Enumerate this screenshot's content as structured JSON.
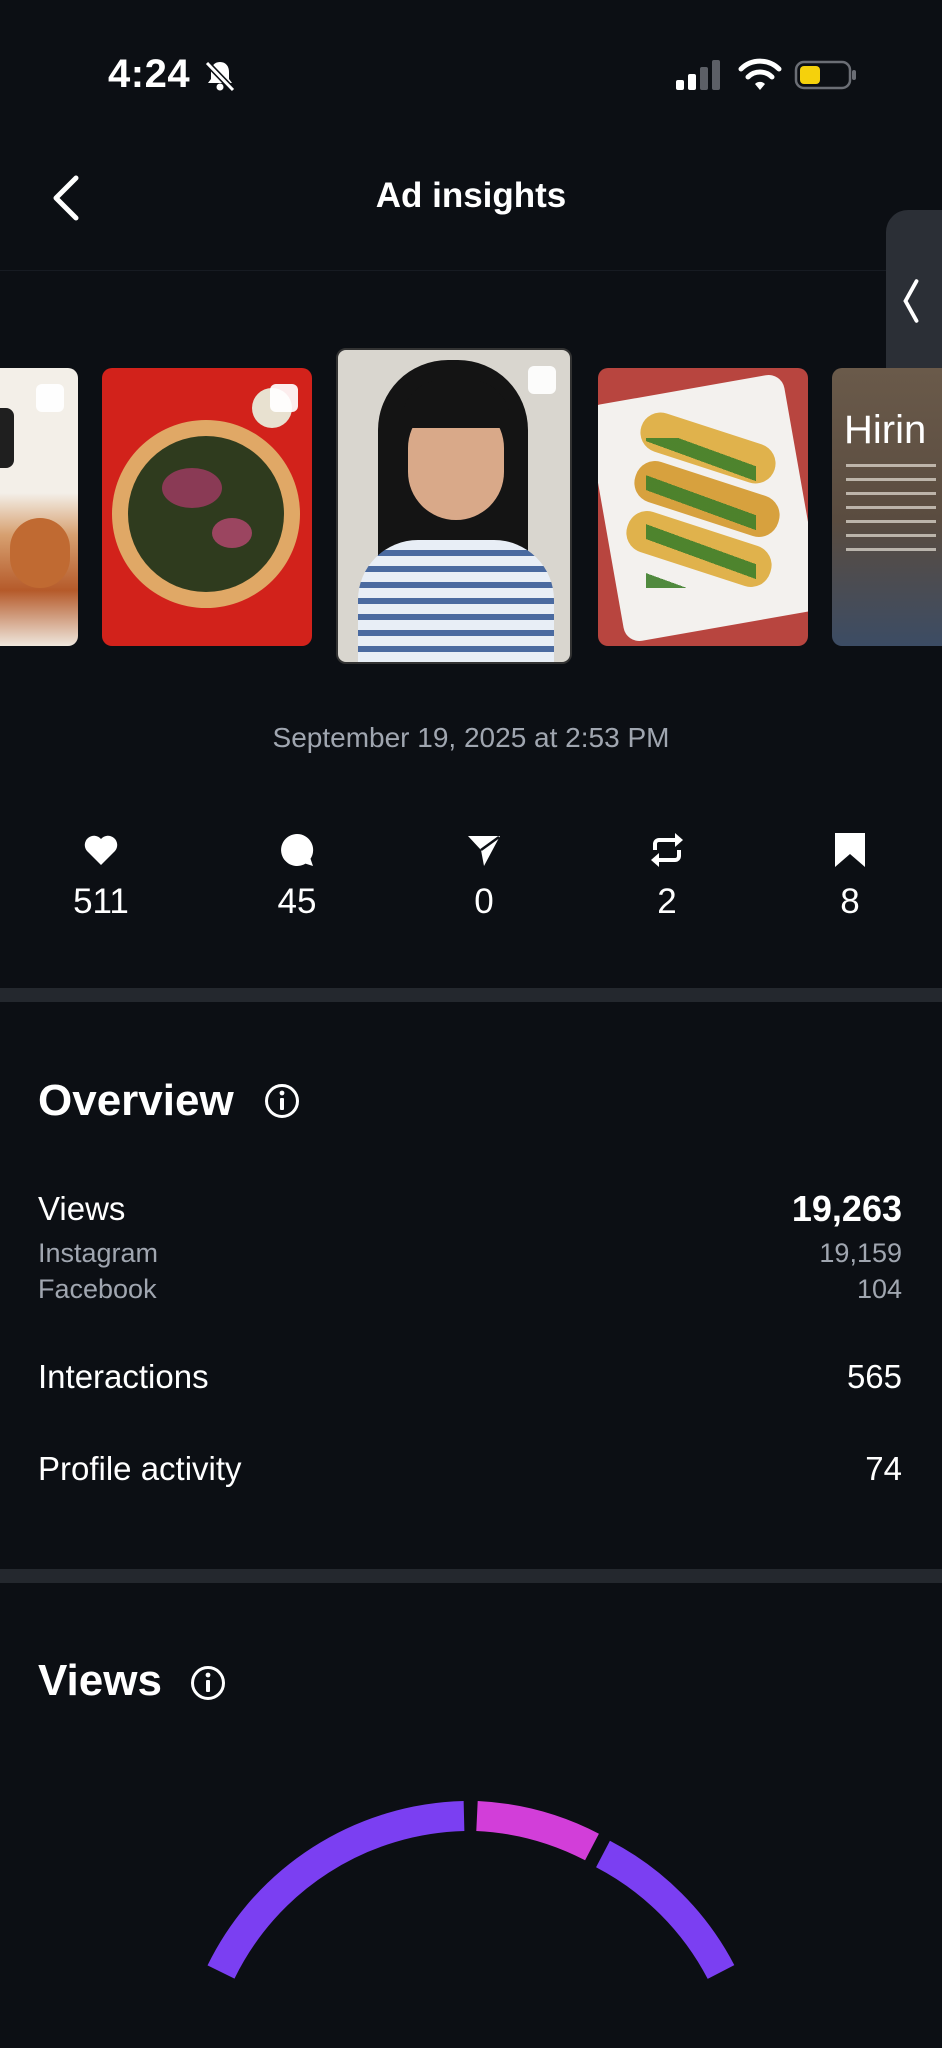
{
  "status_bar": {
    "time": "4:24"
  },
  "header": {
    "title": "Ad insights"
  },
  "thumbnails": [
    {
      "name": "burger-ad-thumbnail"
    },
    {
      "name": "pizza-ad-thumbnail"
    },
    {
      "name": "portrait-ad-thumbnail"
    },
    {
      "name": "tacos-ad-thumbnail"
    },
    {
      "name": "hiring-ad-thumbnail",
      "text": "Hirin"
    }
  ],
  "post_date": "September 19, 2025 at 2:53 PM",
  "stats": {
    "likes": "511",
    "comments": "45",
    "shares": "0",
    "reposts": "2",
    "saves": "8"
  },
  "overview": {
    "title": "Overview",
    "views_label": "Views",
    "views_value": "19,263",
    "instagram_label": "Instagram",
    "instagram_value": "19,159",
    "facebook_label": "Facebook",
    "facebook_value": "104",
    "interactions_label": "Interactions",
    "interactions_value": "565",
    "profile_activity_label": "Profile activity",
    "profile_activity_value": "74"
  },
  "views_section": {
    "title": "Views"
  },
  "colors": {
    "background": "#0c0f14",
    "arc_purple": "#7b3ff2",
    "arc_pink": "#d23ed9"
  }
}
